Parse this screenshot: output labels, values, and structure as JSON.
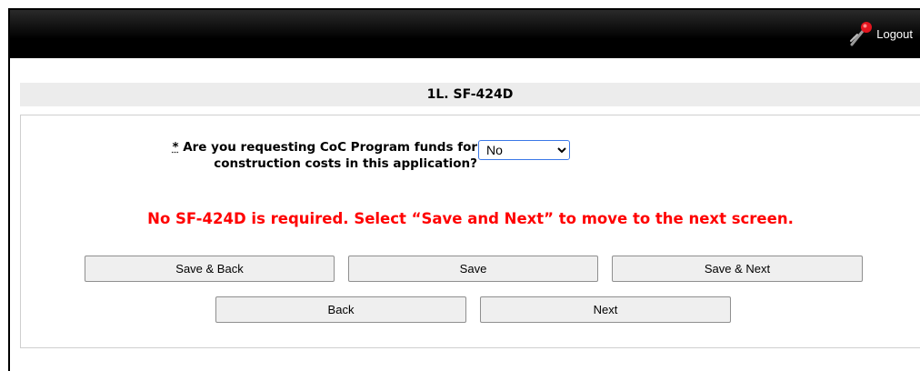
{
  "header": {
    "logout_label": "Logout"
  },
  "section": {
    "title": "1L. SF-424D"
  },
  "question": {
    "required_marker": "*",
    "text": "Are you requesting CoC Program funds for construction costs in this application?",
    "selected_value": "No"
  },
  "notice": {
    "text": "No SF-424D is required. Select “Save and Next” to move to the next screen."
  },
  "buttons": {
    "save_back": "Save & Back",
    "save": "Save",
    "save_next": "Save & Next",
    "back": "Back",
    "next": "Next"
  },
  "colors": {
    "notice": "#ff0000",
    "topbar": "#000000",
    "select_border": "#3b78e7"
  }
}
